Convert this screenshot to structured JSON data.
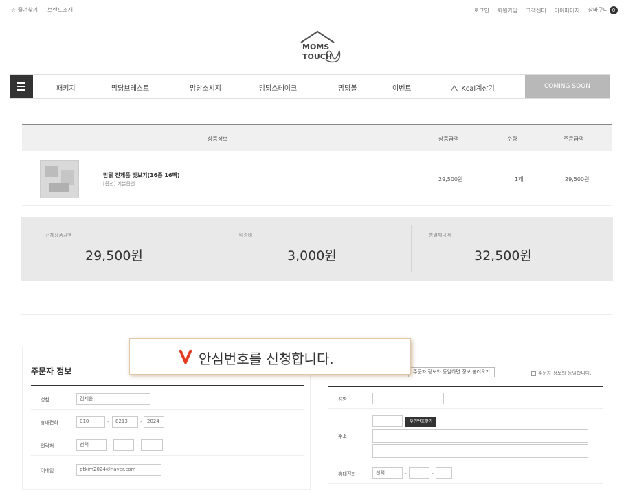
{
  "topbar": {
    "links_left": [
      "☆ 즐겨찾기",
      "브랜드소개"
    ],
    "links_right": [
      "로그인",
      "회원가입",
      "고객센터",
      "마이페이지",
      "장바구니"
    ],
    "cart_count": "0"
  },
  "logo": {
    "line1": "MOMS",
    "line2": "TOUCH"
  },
  "nav": {
    "menu_icon": "hamburger-icon",
    "items": [
      "패키지",
      "맘닭브레스트",
      "맘닭소시지",
      "맘닭스테이크",
      "맘닭볼",
      "이벤트",
      "Kcal계산기"
    ],
    "coming_soon": "COMING SOON"
  },
  "order_table": {
    "headers": {
      "product": "상품정보",
      "price": "상품금액",
      "qty": "수량",
      "total": "주문금액"
    },
    "rows": [
      {
        "name": "맘닭 전제품 맛보기(16종 16팩)",
        "option": "[옵션] 기본옵션",
        "price": "29,500원",
        "qty": "1개",
        "total": "29,500원"
      }
    ]
  },
  "summary": {
    "product_label": "전체상품금액",
    "product_amount": "29,500원",
    "shipping_label": "배송비",
    "shipping_amount": "3,000원",
    "total_label": "총결제금액",
    "total_amount": "32,500원"
  },
  "orderer": {
    "title": "주문자 정보",
    "fields": {
      "name_label": "성함",
      "name_value": "김세윤",
      "mobile_label": "휴대전화",
      "mobile_1": "010",
      "mobile_2": "8213",
      "mobile_3": "2024",
      "phone_label": "연락처",
      "phone_1": "선택",
      "email_label": "이메일",
      "email_value": "ptkim2024@naver.com"
    }
  },
  "receiver": {
    "same_info_button": "주문자 정보와 동일하면 정보 불러오기",
    "same_info_check": "주문자 정보와 동일합니다.",
    "fields": {
      "name_label": "성함",
      "address_label": "주소",
      "zip_button": "우편번호찾기",
      "mobile_label": "휴대전화",
      "mobile_1": "선택"
    }
  },
  "callout": {
    "text": "안심번호를 신청합니다.",
    "mark": "V"
  },
  "colors": {
    "nav_dark": "#333333",
    "coming_soon": "#b8b8b8",
    "summary_bg": "#e9e9e9",
    "callout_mark": "#e23b1f"
  }
}
